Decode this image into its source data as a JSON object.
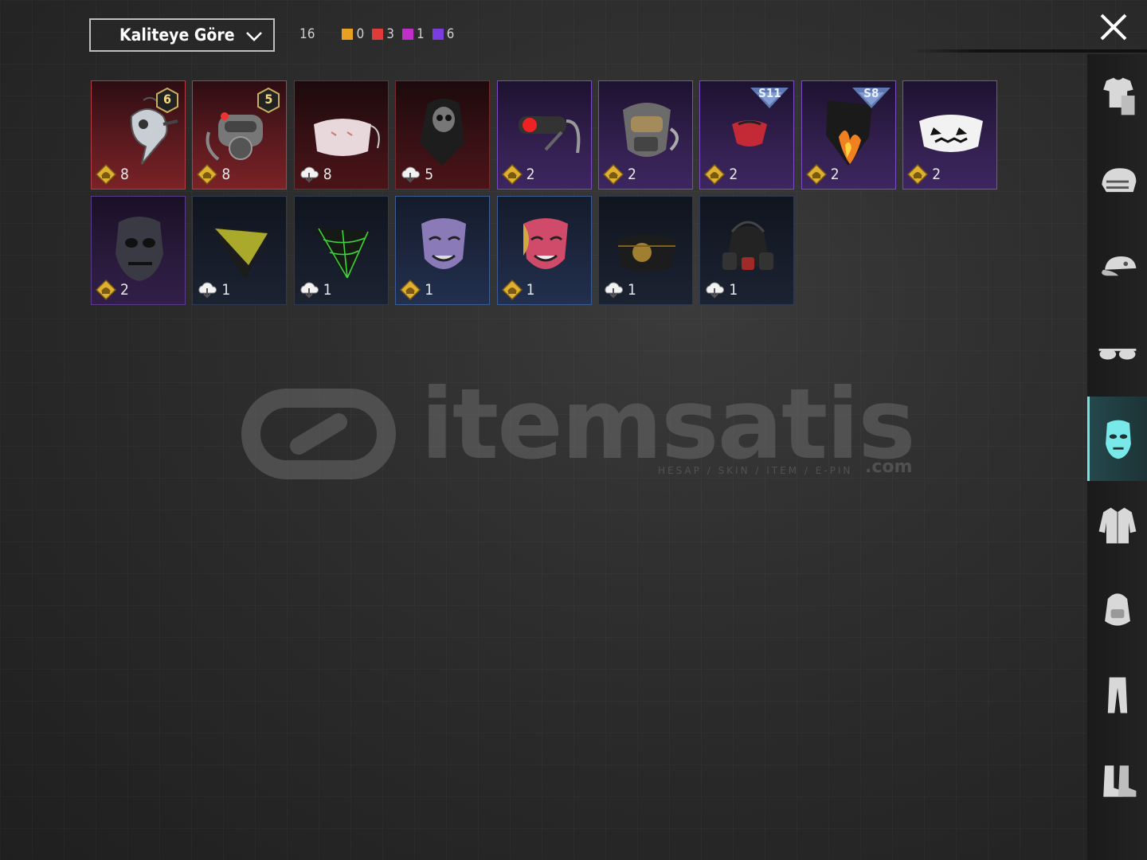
{
  "sort": {
    "label": "Kaliteye Göre"
  },
  "counts": {
    "total": "16",
    "groups": [
      {
        "color": "#e8a020",
        "value": "0"
      },
      {
        "color": "#e03a3a",
        "value": "3"
      },
      {
        "color": "#c030c8",
        "value": "1"
      },
      {
        "color": "#7a3ee0",
        "value": "6"
      }
    ]
  },
  "items": [
    {
      "name": "plague-doctor-mask",
      "quality": "red",
      "currency": "premium",
      "qty": "8",
      "level": "6"
    },
    {
      "name": "cyber-gas-mask",
      "quality": "red",
      "currency": "premium",
      "qty": "8",
      "level": "5"
    },
    {
      "name": "pink-cloth-mask",
      "quality": "red-dark",
      "currency": "cloud",
      "qty": "8"
    },
    {
      "name": "skull-bandana",
      "quality": "red-dark",
      "currency": "cloud",
      "qty": "5"
    },
    {
      "name": "red-eye-visor",
      "quality": "purple",
      "currency": "premium",
      "qty": "2"
    },
    {
      "name": "tactical-rebreather",
      "quality": "purple",
      "currency": "premium",
      "qty": "2"
    },
    {
      "name": "red-half-mask",
      "quality": "purple",
      "currency": "premium",
      "qty": "2",
      "season": "S11"
    },
    {
      "name": "flame-bandana",
      "quality": "purple",
      "currency": "premium",
      "qty": "2",
      "season": "S8"
    },
    {
      "name": "jack-o-lantern-mask",
      "quality": "purple",
      "currency": "premium",
      "qty": "2"
    },
    {
      "name": "dark-skull-mask",
      "quality": "purple-dark",
      "currency": "premium",
      "qty": "2"
    },
    {
      "name": "yellow-dot-bandana",
      "quality": "dark",
      "currency": "cloud",
      "qty": "1"
    },
    {
      "name": "spiderweb-bandana",
      "quality": "dark",
      "currency": "cloud",
      "qty": "1"
    },
    {
      "name": "purple-theater-mask",
      "quality": "blue",
      "currency": "premium",
      "qty": "1"
    },
    {
      "name": "pink-theater-mask",
      "quality": "blue",
      "currency": "premium",
      "qty": "1"
    },
    {
      "name": "gold-emblem-mask",
      "quality": "dark",
      "currency": "cloud",
      "qty": "1"
    },
    {
      "name": "respirator-mask",
      "quality": "dark",
      "currency": "cloud",
      "qty": "1"
    }
  ],
  "watermark": {
    "brand": "itemsatis",
    "tagline": "HESAP / SKIN / ITEM / E-PIN",
    "suffix": ".com"
  },
  "sidebar": [
    {
      "name": "outfit-icon",
      "active": false
    },
    {
      "name": "helmet-icon",
      "active": false
    },
    {
      "name": "cap-icon",
      "active": false
    },
    {
      "name": "glasses-icon",
      "active": false
    },
    {
      "name": "mask-icon",
      "active": true
    },
    {
      "name": "jacket-icon",
      "active": false
    },
    {
      "name": "backpack-icon",
      "active": false
    },
    {
      "name": "pants-icon",
      "active": false
    },
    {
      "name": "boots-icon",
      "active": false
    }
  ]
}
